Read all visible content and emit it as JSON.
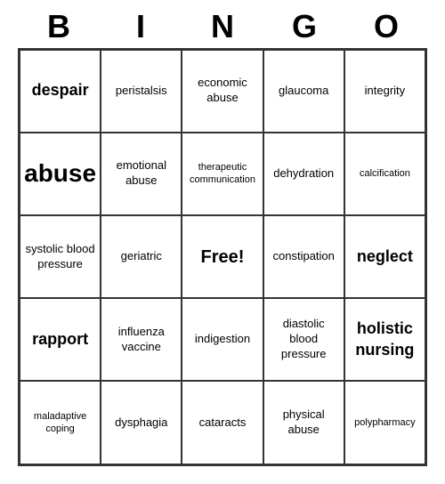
{
  "header": {
    "letters": [
      "B",
      "I",
      "N",
      "G",
      "O"
    ]
  },
  "cells": [
    {
      "text": "despair",
      "size": "large"
    },
    {
      "text": "peristalsis",
      "size": "normal"
    },
    {
      "text": "economic abuse",
      "size": "normal"
    },
    {
      "text": "glaucoma",
      "size": "normal"
    },
    {
      "text": "integrity",
      "size": "normal"
    },
    {
      "text": "abuse",
      "size": "xlarge"
    },
    {
      "text": "emotional abuse",
      "size": "normal"
    },
    {
      "text": "therapeutic communication",
      "size": "small"
    },
    {
      "text": "dehydration",
      "size": "normal"
    },
    {
      "text": "calcification",
      "size": "small"
    },
    {
      "text": "systolic blood pressure",
      "size": "normal"
    },
    {
      "text": "geriatric",
      "size": "normal"
    },
    {
      "text": "Free!",
      "size": "free"
    },
    {
      "text": "constipation",
      "size": "normal"
    },
    {
      "text": "neglect",
      "size": "large"
    },
    {
      "text": "rapport",
      "size": "large"
    },
    {
      "text": "influenza vaccine",
      "size": "normal"
    },
    {
      "text": "indigestion",
      "size": "normal"
    },
    {
      "text": "diastolic blood pressure",
      "size": "normal"
    },
    {
      "text": "holistic nursing",
      "size": "large"
    },
    {
      "text": "maladaptive coping",
      "size": "small"
    },
    {
      "text": "dysphagia",
      "size": "normal"
    },
    {
      "text": "cataracts",
      "size": "normal"
    },
    {
      "text": "physical abuse",
      "size": "normal"
    },
    {
      "text": "polypharmacy",
      "size": "small"
    }
  ]
}
